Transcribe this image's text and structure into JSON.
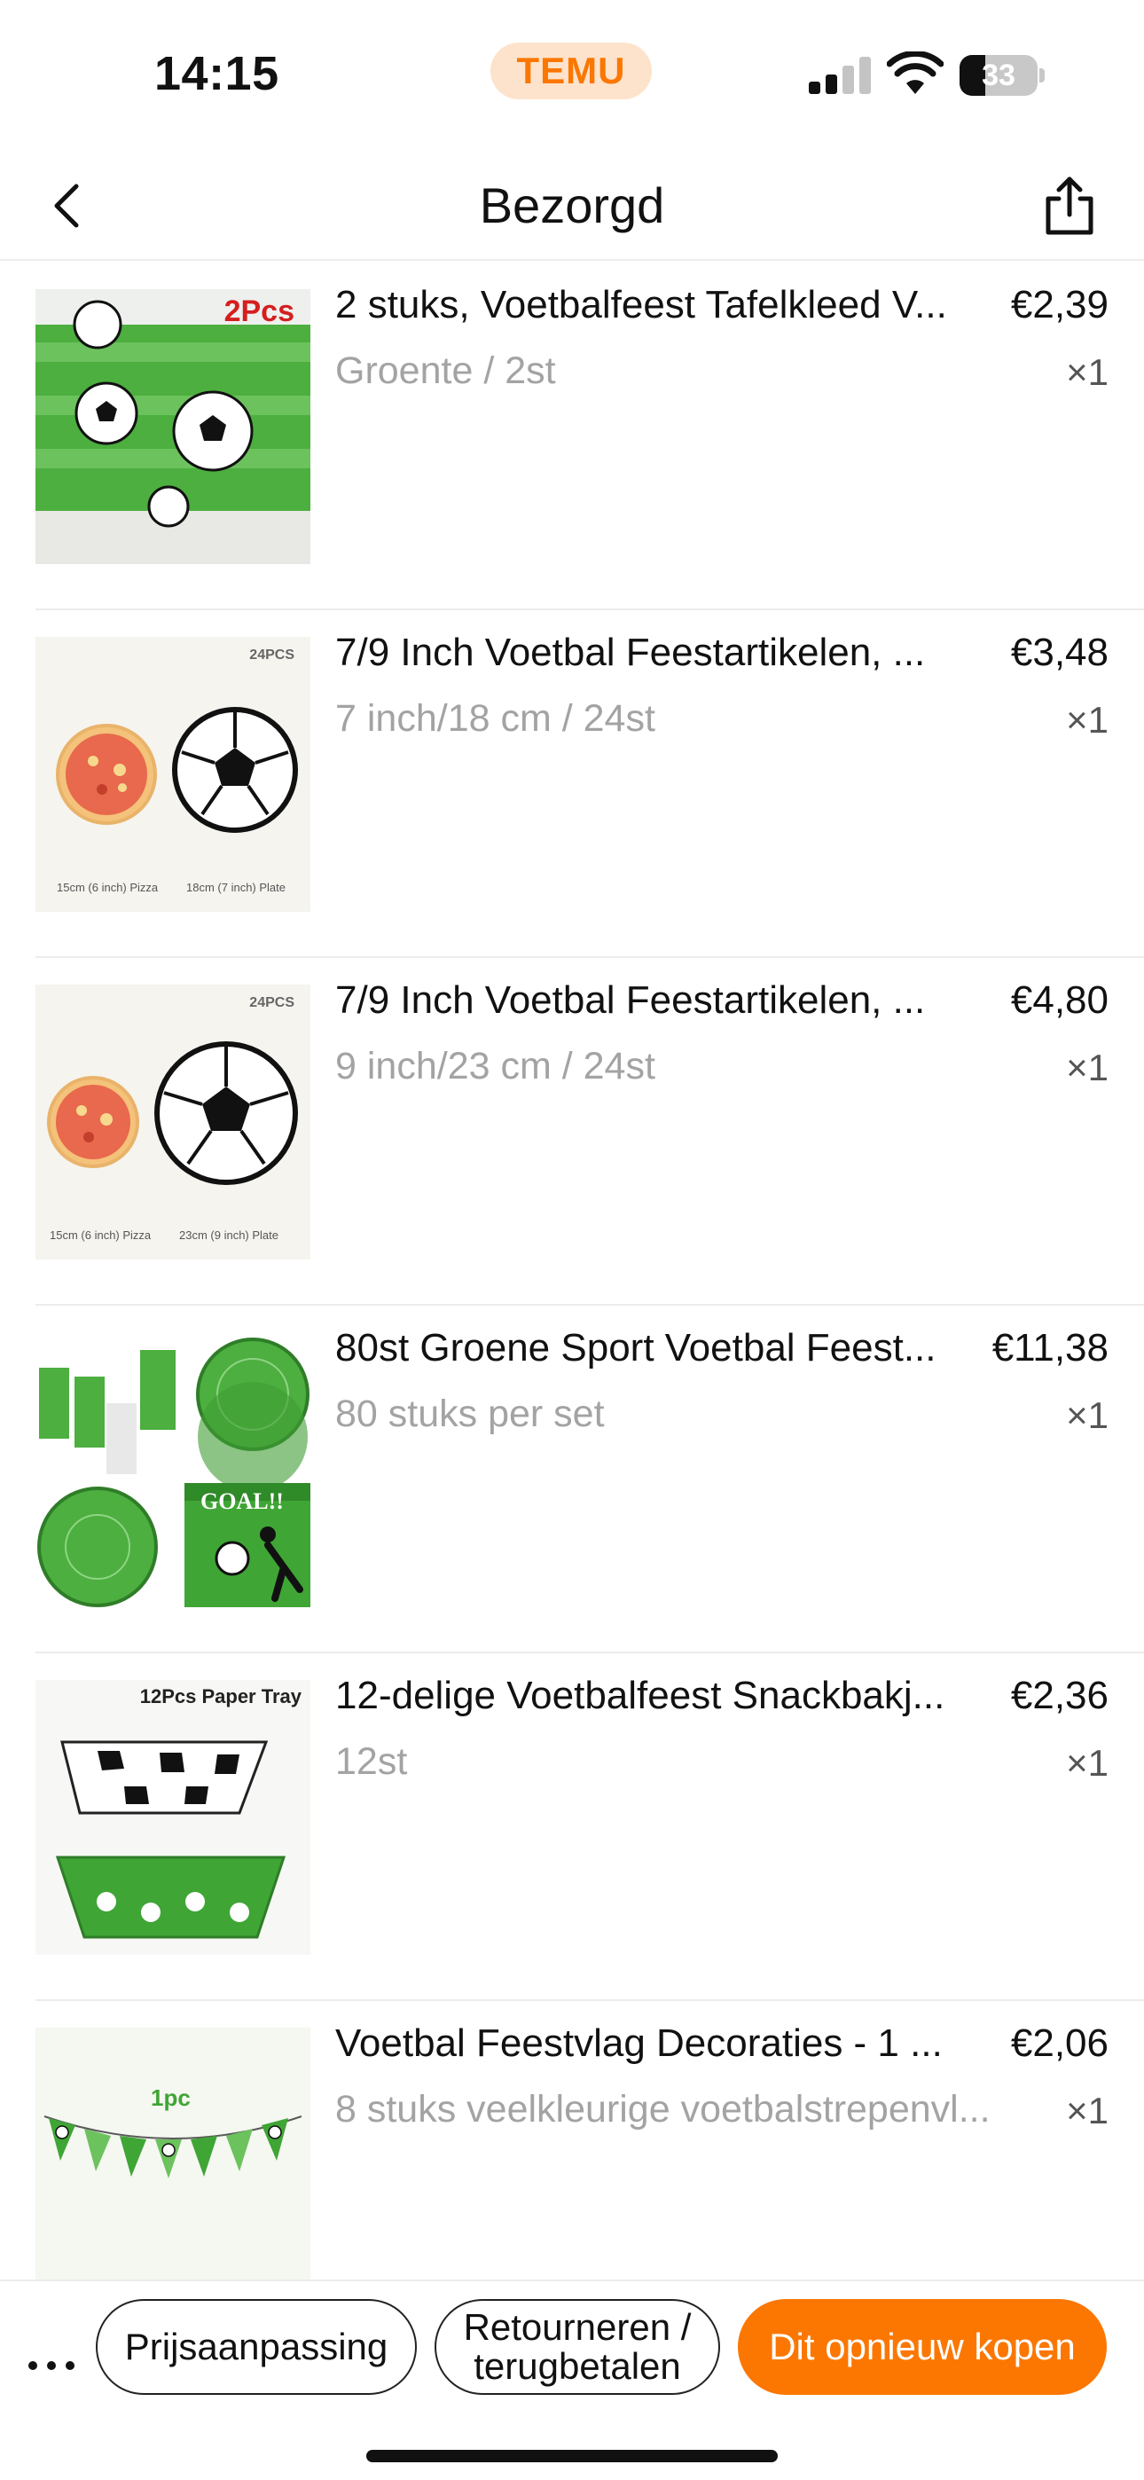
{
  "status_bar": {
    "time": "14:15",
    "carrier_badge": "TEMU",
    "battery_level": "33",
    "battery_fraction": 0.33,
    "icons": [
      "cellular-signal-icon",
      "wifi-icon",
      "battery-icon"
    ]
  },
  "header": {
    "title": "Bezorgd",
    "back_icon": "chevron-left-icon",
    "share_icon": "share-icon"
  },
  "items": [
    {
      "title": "2 stuks, Voetbalfeest Tafelkleed V...",
      "variant": "Groente / 2st",
      "price": "€2,39",
      "qty": "×1",
      "thumb_label": "2Pcs"
    },
    {
      "title": "7/9 Inch Voetbal Feestartikelen, ...",
      "variant": "7 inch/18 cm / 24st",
      "price": "€3,48",
      "qty": "×1",
      "thumb_label": "24PCS",
      "thumb_caption_left": "15cm (6 inch) Pizza",
      "thumb_caption_right": "18cm (7 inch) Plate"
    },
    {
      "title": "7/9 Inch Voetbal Feestartikelen, ...",
      "variant": "9 inch/23 cm / 24st",
      "price": "€4,80",
      "qty": "×1",
      "thumb_label": "24PCS",
      "thumb_caption_left": "15cm (6 inch) Pizza",
      "thumb_caption_right": "23cm (9 inch) Plate"
    },
    {
      "title": "80st Groene Sport Voetbal Feest...",
      "variant": "80 stuks per set",
      "price": "€11,38",
      "qty": "×1",
      "thumb_label": "GOAL!!"
    },
    {
      "title": "12-delige Voetbalfeest Snackbakj...",
      "variant": "12st",
      "price": "€2,36",
      "qty": "×1",
      "thumb_label": "12Pcs Paper Tray"
    },
    {
      "title": "Voetbal Feestvlag Decoraties - 1 ...",
      "variant": "8 stuks veelkleurige voetbalstrepenvl...",
      "price": "€2,06",
      "qty": "×1",
      "thumb_label": "1pc"
    }
  ],
  "actions": {
    "more_icon": "more-dots-icon",
    "price_adjust": "Prijsaanpassing",
    "return_line1": "Retourneren /",
    "return_line2": "terugbetalen",
    "buy_again": "Dit opnieuw kopen"
  },
  "colors": {
    "accent": "#fb7701",
    "temu_badge_bg": "#fde3cc",
    "muted_text": "#a3a3a3",
    "divider": "#ececec",
    "field_green": "#3fa535"
  }
}
